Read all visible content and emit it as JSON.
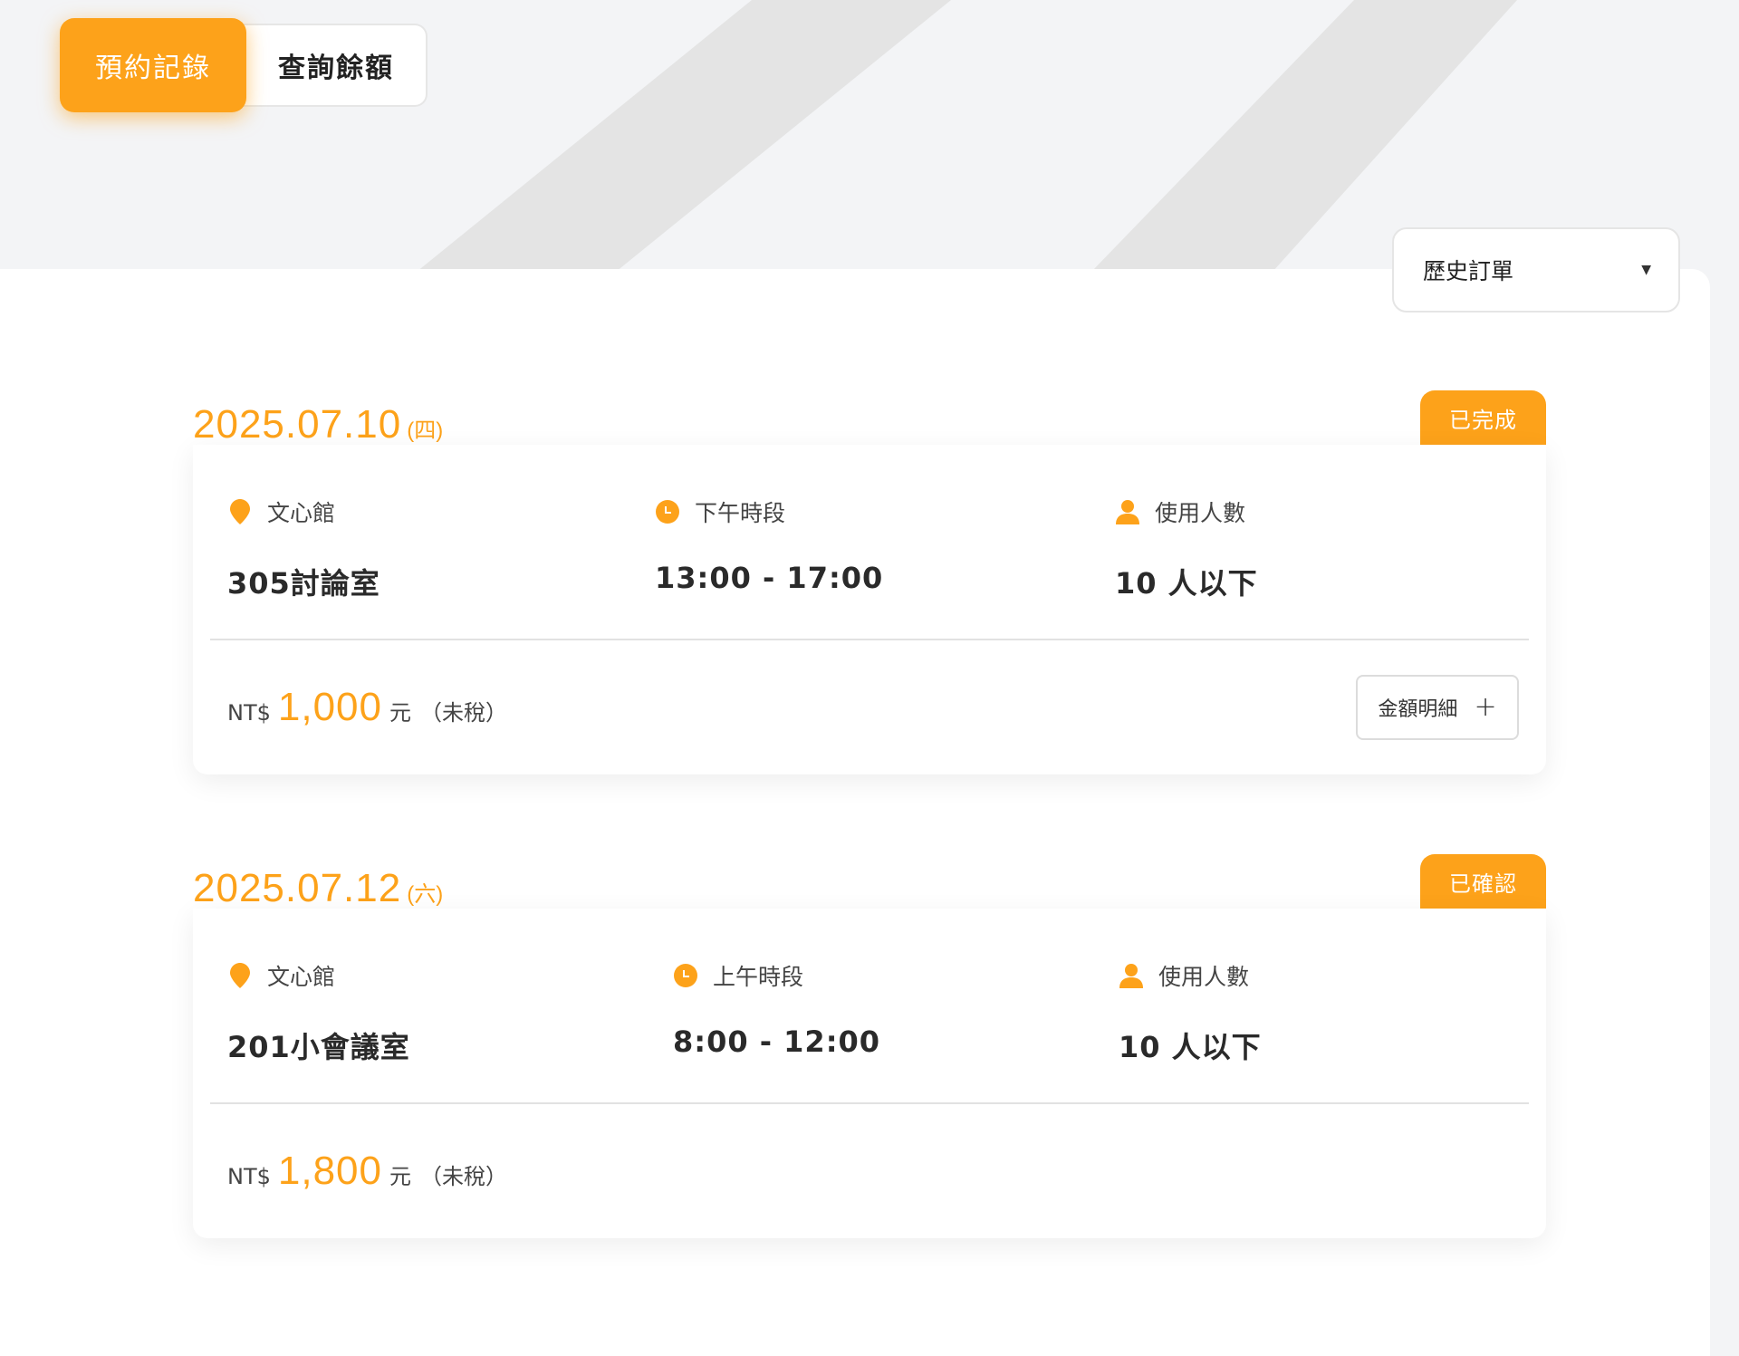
{
  "tabs": [
    {
      "label": "預約記錄",
      "active": true
    },
    {
      "label": "查詢餘額",
      "active": false
    }
  ],
  "filter": {
    "selected": "歷史訂單",
    "caret": "▼"
  },
  "colors": {
    "accent": "#fda21a",
    "stripe": "#e4e4e4",
    "background": "#f3f4f6"
  },
  "orders": [
    {
      "date": "2025.07.10",
      "weekday": "(四)",
      "status": "已完成",
      "venue_label": "文心館",
      "room": "305討論室",
      "slot_label": "下午時段",
      "time": "13:00 - 17:00",
      "people_label": "使用人數",
      "people": "10 人以下",
      "currency": "NT$",
      "amount": "1,000",
      "unit": "元",
      "tax_note": "（未稅）",
      "detail_label": "金額明細",
      "detail_icon": "+"
    },
    {
      "date": "2025.07.12",
      "weekday": "(六)",
      "status": "已確認",
      "venue_label": "文心館",
      "room": "201小會議室",
      "slot_label": "上午時段",
      "time": "8:00 - 12:00",
      "people_label": "使用人數",
      "people": "10 人以下",
      "currency": "NT$",
      "amount": "1,800",
      "unit": "元",
      "tax_note": "（未稅）"
    }
  ]
}
